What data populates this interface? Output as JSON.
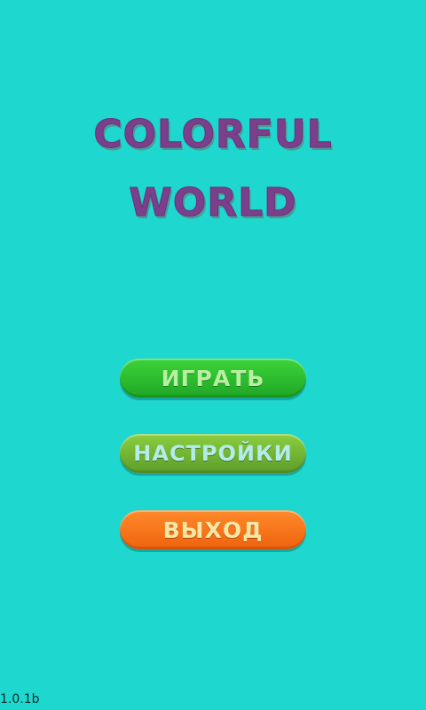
{
  "title": {
    "line1": "COLORFUL",
    "line2": "WORLD"
  },
  "menu": {
    "play_label": "ИГРАТЬ",
    "settings_label": "НАСТРОЙКИ",
    "exit_label": "ВЫХОД"
  },
  "footer": {
    "version": "1.0.1b"
  },
  "colors": {
    "background": "#1ed8cf",
    "title": "#7b3f8c",
    "play_button": "#2bbd2e",
    "settings_button": "#76b637",
    "exit_button": "#f87620"
  }
}
